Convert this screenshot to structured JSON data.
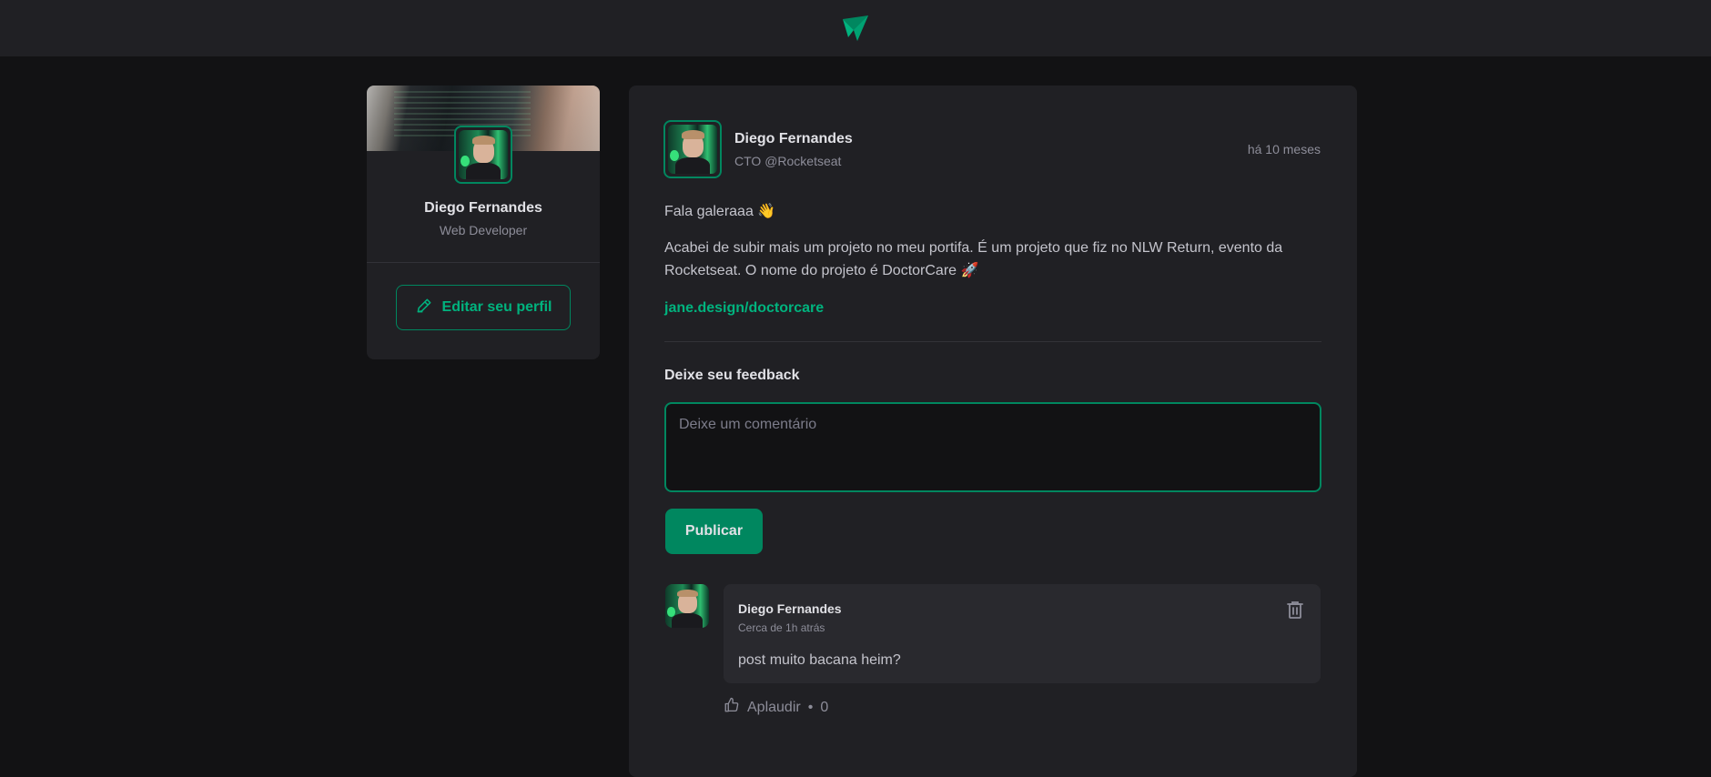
{
  "header": {
    "logo_icon": "rocket-paper-plane-logo"
  },
  "sidebar": {
    "name": "Diego Fernandes",
    "role": "Web Developer",
    "edit_button_label": "Editar seu perfil"
  },
  "post": {
    "author_name": "Diego Fernandes",
    "author_role": "CTO @Rocketseat",
    "published": "há 10 meses",
    "paragraph_1": "Fala galeraaa 👋",
    "paragraph_2": "Acabei de subir mais um projeto no meu portifa. É um projeto que fiz no NLW Return, evento da Rocketseat. O nome do projeto é DoctorCare 🚀",
    "link": "jane.design/doctorcare",
    "feedback_title": "Deixe seu feedback",
    "comment_placeholder": "Deixe um comentário",
    "comment_value": "",
    "publish_button_label": "Publicar"
  },
  "comment": {
    "author_name": "Diego Fernandes",
    "time": "Cerca de 1h atrás",
    "text": "post muito bacana heim?",
    "applaud_label": "Aplaudir",
    "applaud_separator": "•",
    "applaud_count": "0"
  },
  "colors": {
    "background": "#121214",
    "panel": "#202024",
    "accent": "#00875f",
    "accent_light": "#00b37e",
    "text": "#c4c4cc",
    "heading": "#e1e1e6"
  }
}
